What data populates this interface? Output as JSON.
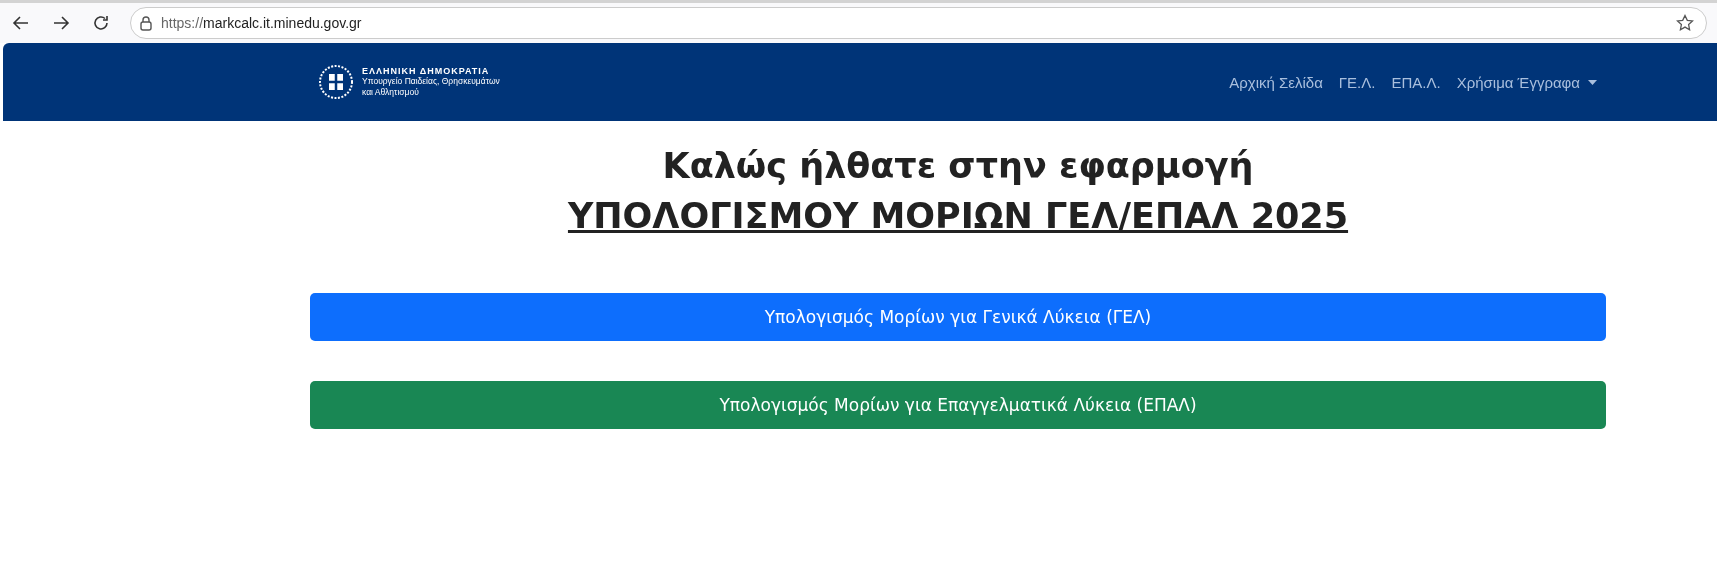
{
  "browser": {
    "url_scheme": "https://",
    "url_host": "markcalc.it.minedu.gov.gr"
  },
  "header": {
    "logo": {
      "title": "ΕΛΛΗΝΙΚΗ ΔΗΜΟΚΡΑΤΙΑ",
      "subtitle_line_1": "Υπουργείο Παιδείας, Θρησκευμάτων",
      "subtitle_line_2": "και Αθλητισμού"
    },
    "nav": [
      {
        "label": "Αρχική Σελίδα",
        "kind": "link"
      },
      {
        "label": "ΓΕ.Λ.",
        "kind": "link"
      },
      {
        "label": "ΕΠΑ.Λ.",
        "kind": "link"
      },
      {
        "label": "Χρήσιμα Έγγραφα",
        "kind": "dropdown"
      }
    ]
  },
  "heading": {
    "line_1": "Καλώς ήλθατε στην εφαρμογή",
    "line_2": "ΥΠΟΛΟΓΙΣΜΟΥ ΜΟΡΙΩΝ ΓΕΛ/ΕΠΑΛ 2025"
  },
  "buttons": [
    {
      "label": "Υπολογισμός Μορίων για Γενικά Λύκεια (ΓΕΛ)",
      "color": "#0d6efd"
    },
    {
      "label": "Υπολογισμός Μορίων για Επαγγελματικά Λύκεια (ΕΠΑΛ)",
      "color": "#198754"
    }
  ]
}
